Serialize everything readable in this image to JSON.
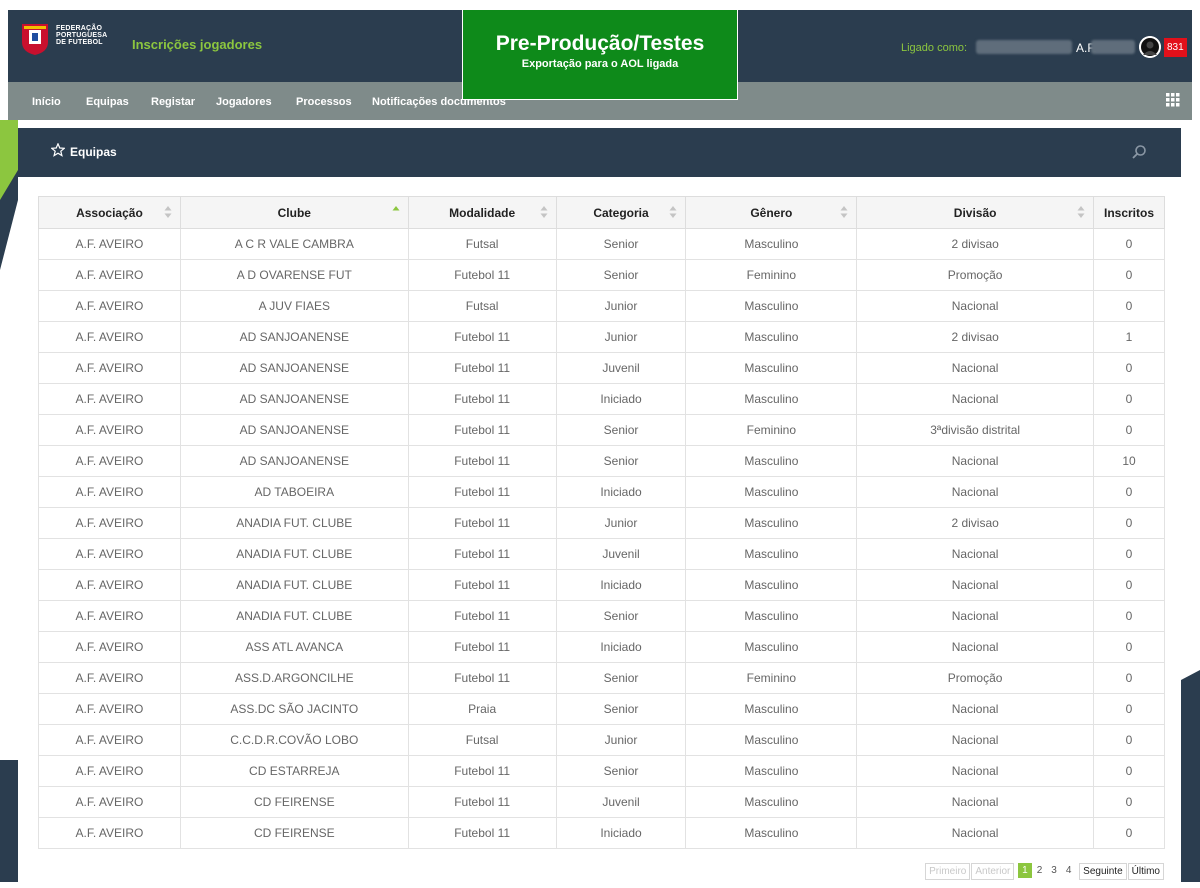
{
  "header": {
    "federation_lines": [
      "FEDERAÇÃO",
      "PORTUGUESA",
      "DE FUTEBOL"
    ],
    "app_title": "Inscrições jogadores",
    "environment_title": "Pre-Produção/Testes",
    "environment_subtitle": "Exportação para o AOL ligada",
    "logged_in_label": "Ligado como:",
    "user_affiliation": "A.F.",
    "notification_count": "831"
  },
  "nav": {
    "items": [
      "Início",
      "Equipas",
      "Registar",
      "Jogadores",
      "Processos",
      "Notificações documentos"
    ],
    "apps_icon": "grid-icon"
  },
  "panel": {
    "title": "Equipas",
    "title_icon": "star-icon",
    "search_icon": "search-icon"
  },
  "table": {
    "columns": [
      "Associação",
      "Clube",
      "Modalidade",
      "Categoria",
      "Gênero",
      "Divisão",
      "Inscritos"
    ],
    "sorted_column": "Clube",
    "rows": [
      [
        "A.F. AVEIRO",
        "A C R VALE CAMBRA",
        "Futsal",
        "Senior",
        "Masculino",
        "2 divisao",
        "0"
      ],
      [
        "A.F. AVEIRO",
        "A D OVARENSE FUT",
        "Futebol 11",
        "Senior",
        "Feminino",
        "Promoção",
        "0"
      ],
      [
        "A.F. AVEIRO",
        "A JUV FIAES",
        "Futsal",
        "Junior",
        "Masculino",
        "Nacional",
        "0"
      ],
      [
        "A.F. AVEIRO",
        "AD SANJOANENSE",
        "Futebol 11",
        "Junior",
        "Masculino",
        "2 divisao",
        "1"
      ],
      [
        "A.F. AVEIRO",
        "AD SANJOANENSE",
        "Futebol 11",
        "Juvenil",
        "Masculino",
        "Nacional",
        "0"
      ],
      [
        "A.F. AVEIRO",
        "AD SANJOANENSE",
        "Futebol 11",
        "Iniciado",
        "Masculino",
        "Nacional",
        "0"
      ],
      [
        "A.F. AVEIRO",
        "AD SANJOANENSE",
        "Futebol 11",
        "Senior",
        "Feminino",
        "3ªdivisão distrital",
        "0"
      ],
      [
        "A.F. AVEIRO",
        "AD SANJOANENSE",
        "Futebol 11",
        "Senior",
        "Masculino",
        "Nacional",
        "10"
      ],
      [
        "A.F. AVEIRO",
        "AD TABOEIRA",
        "Futebol 11",
        "Iniciado",
        "Masculino",
        "Nacional",
        "0"
      ],
      [
        "A.F. AVEIRO",
        "ANADIA FUT. CLUBE",
        "Futebol 11",
        "Junior",
        "Masculino",
        "2 divisao",
        "0"
      ],
      [
        "A.F. AVEIRO",
        "ANADIA FUT. CLUBE",
        "Futebol 11",
        "Juvenil",
        "Masculino",
        "Nacional",
        "0"
      ],
      [
        "A.F. AVEIRO",
        "ANADIA FUT. CLUBE",
        "Futebol 11",
        "Iniciado",
        "Masculino",
        "Nacional",
        "0"
      ],
      [
        "A.F. AVEIRO",
        "ANADIA FUT. CLUBE",
        "Futebol 11",
        "Senior",
        "Masculino",
        "Nacional",
        "0"
      ],
      [
        "A.F. AVEIRO",
        "ASS ATL AVANCA",
        "Futebol 11",
        "Iniciado",
        "Masculino",
        "Nacional",
        "0"
      ],
      [
        "A.F. AVEIRO",
        "ASS.D.ARGONCILHE",
        "Futebol 11",
        "Senior",
        "Feminino",
        "Promoção",
        "0"
      ],
      [
        "A.F. AVEIRO",
        "ASS.DC SÃO JACINTO",
        "Praia",
        "Senior",
        "Masculino",
        "Nacional",
        "0"
      ],
      [
        "A.F. AVEIRO",
        "C.C.D.R.COVÃO LOBO",
        "Futsal",
        "Junior",
        "Masculino",
        "Nacional",
        "0"
      ],
      [
        "A.F. AVEIRO",
        "CD ESTARREJA",
        "Futebol 11",
        "Senior",
        "Masculino",
        "Nacional",
        "0"
      ],
      [
        "A.F. AVEIRO",
        "CD FEIRENSE",
        "Futebol 11",
        "Juvenil",
        "Masculino",
        "Nacional",
        "0"
      ],
      [
        "A.F. AVEIRO",
        "CD FEIRENSE",
        "Futebol 11",
        "Iniciado",
        "Masculino",
        "Nacional",
        "0"
      ]
    ]
  },
  "pagination": {
    "first": "Primeiro",
    "previous": "Anterior",
    "pages": [
      "1",
      "2",
      "3",
      "4"
    ],
    "current_page": "1",
    "next": "Seguinte",
    "last": "Último"
  },
  "colors": {
    "header_bg": "#2b3d4f",
    "nav_bg": "#7f8b8a",
    "accent_green": "#8cc63f",
    "environment_green": "#0e8a1a",
    "badge_red": "#e2101a"
  }
}
